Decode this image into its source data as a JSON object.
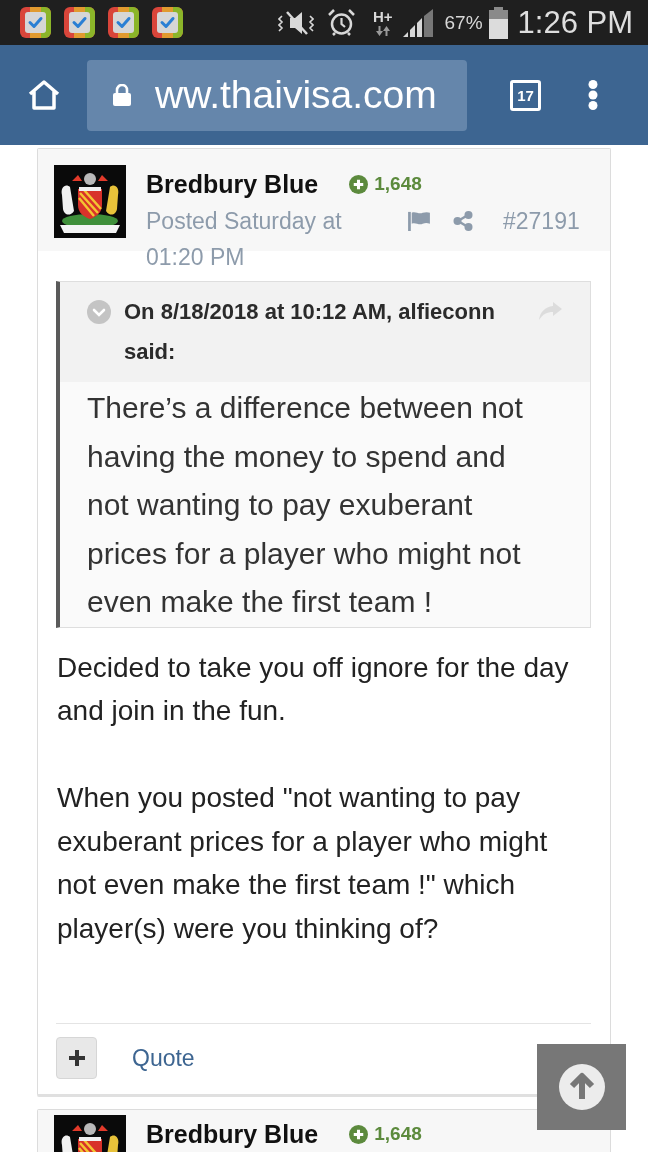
{
  "status_bar": {
    "network_type": "H+",
    "battery": "67%",
    "time": "1:26 PM"
  },
  "browser_bar": {
    "url": "ww.thaivisa.com",
    "tab_count": "17"
  },
  "posts": [
    {
      "author": "Bredbury Blue",
      "reputation": "1,648",
      "posted": "Posted Saturday at 01:20 PM",
      "post_number": "#27191",
      "quote": {
        "attribution": "On 8/18/2018 at 10:12 AM, alfieconn said:",
        "text": "There’s a difference between not having the money to spend and not wanting to pay exuberant prices for a player who might not even make the first team !"
      },
      "paragraphs": [
        "Decided to take you off ignore for the day and join in the fun.",
        "When you posted \"not wanting to pay exuberant prices for a player who might not even make the first team !\" which player(s) were you thinking of?"
      ],
      "quote_action": "Quote"
    },
    {
      "author": "Bredbury Blue",
      "reputation": "1,648"
    }
  ]
}
